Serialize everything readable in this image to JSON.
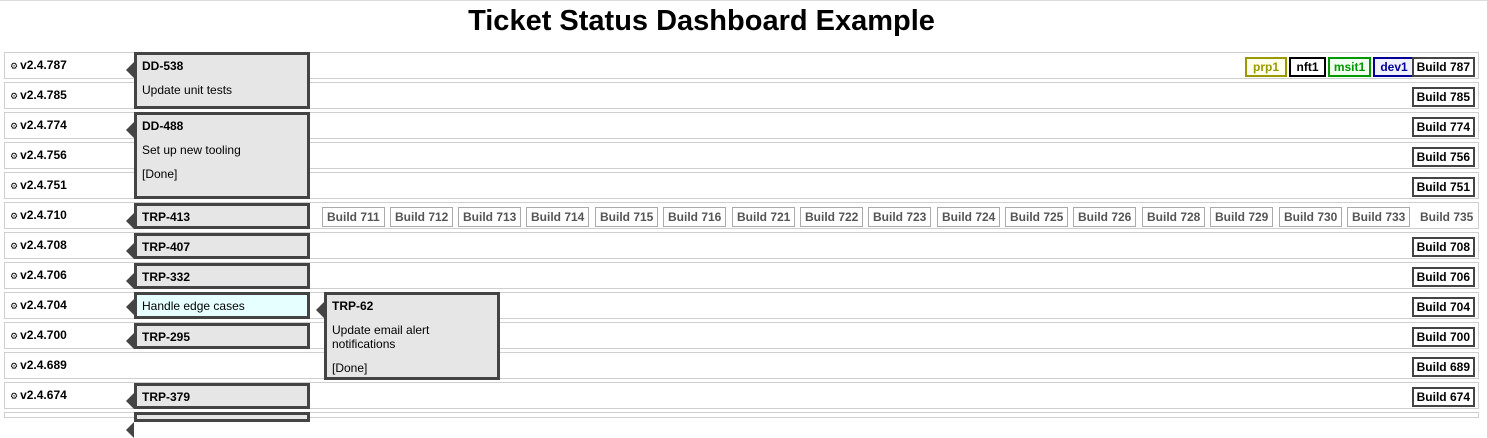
{
  "title": "Ticket Status Dashboard Example",
  "rows": [
    {
      "version": "v2.4.787",
      "build": "Build 787"
    },
    {
      "version": "v2.4.785",
      "build": "Build 785"
    },
    {
      "version": "v2.4.774",
      "build": "Build 774"
    },
    {
      "version": "v2.4.756",
      "build": "Build 756"
    },
    {
      "version": "v2.4.751",
      "build": "Build 751"
    },
    {
      "version": "v2.4.710",
      "build": "Build 735"
    },
    {
      "version": "v2.4.708",
      "build": "Build 708"
    },
    {
      "version": "v2.4.706",
      "build": "Build 706"
    },
    {
      "version": "v2.4.704",
      "build": "Build 704"
    },
    {
      "version": "v2.4.700",
      "build": "Build 700"
    },
    {
      "version": "v2.4.689",
      "build": "Build 689"
    },
    {
      "version": "v2.4.674",
      "build": "Build 674"
    }
  ],
  "icons": {
    "version_icon": "gear-icon",
    "gear_glyph": "⚙"
  },
  "environments": [
    {
      "name": "prp1",
      "color": "#999900"
    },
    {
      "name": "nft1",
      "color": "#000000"
    },
    {
      "name": "msit1",
      "color": "#009900"
    },
    {
      "name": "dev1",
      "color": "#000099"
    }
  ],
  "build_chips": [
    "Build 711",
    "Build 712",
    "Build 713",
    "Build 714",
    "Build 715",
    "Build 716",
    "Build 721",
    "Build 722",
    "Build 723",
    "Build 724",
    "Build 725",
    "Build 726",
    "Build 728",
    "Build 729",
    "Build 730",
    "Build 733"
  ],
  "tickets": {
    "dd538": {
      "id": "DD-538",
      "desc": "Update unit tests"
    },
    "dd488": {
      "id": "DD-488",
      "desc": "Set up new tooling",
      "status": "[Done]"
    },
    "trp413": {
      "id": "TRP-413"
    },
    "trp407": {
      "id": "TRP-407"
    },
    "trp332": {
      "id": "TRP-332"
    },
    "handle": {
      "desc": "Handle edge cases"
    },
    "trp295": {
      "id": "TRP-295"
    },
    "trp62": {
      "id": "TRP-62",
      "desc": "Update email alert notifications",
      "status": "[Done]"
    },
    "trp379": {
      "id": "TRP-379"
    }
  }
}
